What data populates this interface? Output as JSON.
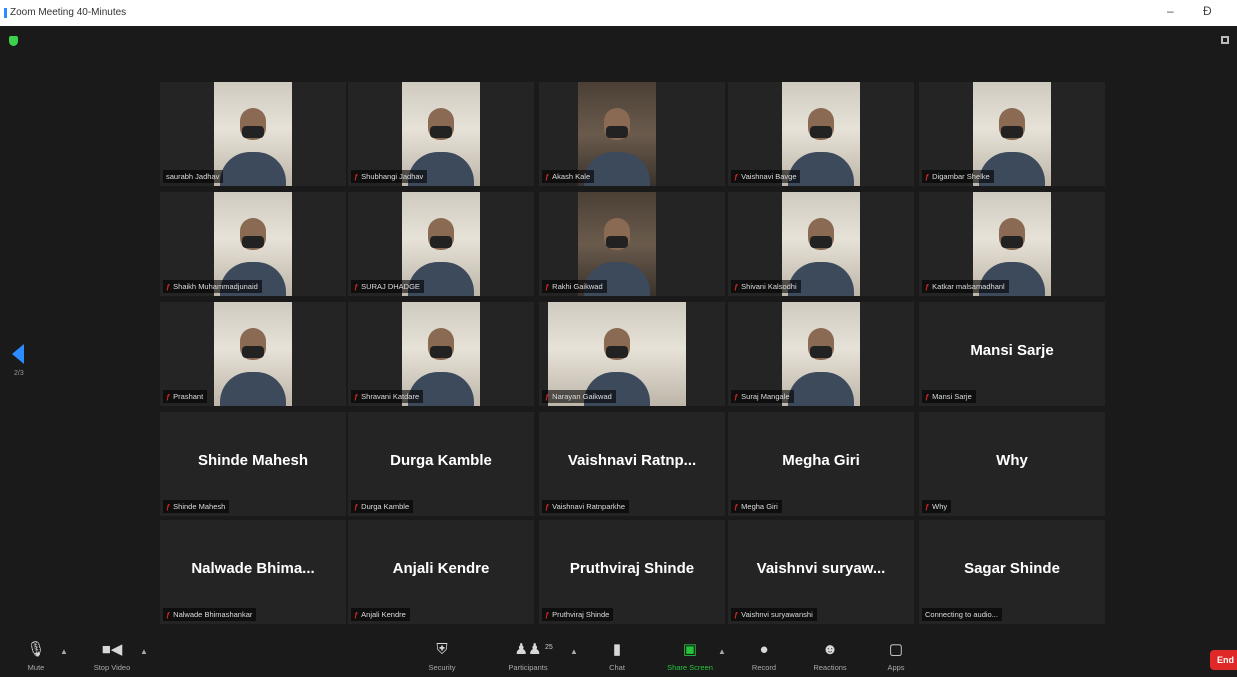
{
  "window": {
    "title": "Zoom Meeting 40-Minutes",
    "minimize": "–",
    "restore": "Ɖ"
  },
  "page_indicator": "2/3",
  "participants": [
    {
      "name": "saurabh Jadhav",
      "video": true
    },
    {
      "name": "Shubhangi Jadhav",
      "video": true
    },
    {
      "name": "Akash Kale",
      "video": true
    },
    {
      "name": "Vaishnavi Bavge",
      "video": true
    },
    {
      "name": "Digambar Shelke",
      "video": true
    },
    {
      "name": "Shaikh Muhammadjunaid",
      "video": true
    },
    {
      "name": "SURAJ DHADGE",
      "video": true
    },
    {
      "name": "Rakhi Gaikwad",
      "video": true
    },
    {
      "name": "Shivani Kalsodhi",
      "video": true
    },
    {
      "name": "Katkar malsamadhanl",
      "video": true
    },
    {
      "name": "Prashant",
      "video": true
    },
    {
      "name": "Shravani Katdare",
      "video": true
    },
    {
      "name": "Narayan Gaikwad",
      "video": true
    },
    {
      "name": "Suraj Mangale",
      "video": true
    },
    {
      "name": "Mansi Sarje",
      "display": "Mansi Sarje",
      "video": false
    },
    {
      "name": "Shinde Mahesh",
      "display": "Shinde Mahesh",
      "video": false
    },
    {
      "name": "Durga Kamble",
      "display": "Durga Kamble",
      "video": false
    },
    {
      "name": "Vaishnavi Ratnparkhe",
      "display": "Vaishnavi  Ratnp...",
      "video": false
    },
    {
      "name": "Megha Giri",
      "display": "Megha Giri",
      "video": false
    },
    {
      "name": "Why",
      "display": "Why",
      "video": false
    },
    {
      "name": "Nalwade Bhimashankar",
      "display": "Nalwade  Bhima...",
      "video": false
    },
    {
      "name": "Anjali Kendre",
      "display": "Anjali Kendre",
      "video": false
    },
    {
      "name": "Pruthviraj Shinde",
      "display": "Pruthviraj Shinde",
      "video": false
    },
    {
      "name": "Vaishnvi suryawanshi",
      "display": "Vaishnvi  suryaw...",
      "video": false
    },
    {
      "name": "Connecting to audio...",
      "display": "Sagar Shinde",
      "video": false
    }
  ],
  "toolbar": {
    "mute": "Mute",
    "stop_video": "Stop Video",
    "security": "Security",
    "participants": "Participants",
    "participants_count": "25",
    "chat": "Chat",
    "share_screen": "Share Screen",
    "record": "Record",
    "reactions": "Reactions",
    "apps": "Apps",
    "end": "End"
  },
  "colors": {
    "accent": "#2d8cff",
    "share": "#24c43a",
    "end": "#e02828",
    "muted_mic": "#e02828"
  }
}
